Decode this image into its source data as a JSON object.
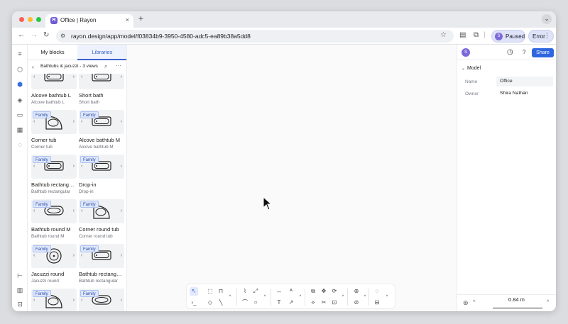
{
  "browser": {
    "tab_title": "Office | Rayon",
    "favicon_letter": "R",
    "new_tab": "+",
    "tab_close": "×",
    "tab_menu": "⌄",
    "url": "rayon.design/app/model/f03834b9-3950-4580-adc5-ea89b38a5dd8",
    "paused_label": "Paused",
    "profile_initial": "S",
    "error_label": "Error",
    "kebab": "⋮",
    "traffic_lights": [
      "#ff5f57",
      "#febc2e",
      "#28c840"
    ]
  },
  "panel": {
    "tabs": [
      {
        "label": "My blocks"
      },
      {
        "label": "Libraries"
      }
    ],
    "active_tab": "Libraries",
    "title": "Bathtubs & jacuzzi - 3 views",
    "back": "‹",
    "search": "⌕",
    "more": "···",
    "badge": "Family",
    "cards": [
      {
        "name": "Alcove bathtub L",
        "sub": "Alcove bathtub L",
        "badge": false,
        "icon": "bathtub-rect-icon"
      },
      {
        "name": "Short bath",
        "sub": "Short bath",
        "badge": false,
        "icon": "bathtub-rect-icon"
      },
      {
        "name": "Corner tub",
        "sub": "Corner tub",
        "badge": true,
        "icon": "corner-tub-icon"
      },
      {
        "name": "Alcove bathtub M",
        "sub": "Alcove bathtub M",
        "badge": true,
        "icon": "bathtub-rect-icon"
      },
      {
        "name": "Bathtub rectangular",
        "sub": "Bathtub rectangular",
        "badge": true,
        "icon": "bathtub-rect-icon"
      },
      {
        "name": "Drop-in",
        "sub": "Drop-in",
        "badge": true,
        "icon": "bathtub-rect-icon"
      },
      {
        "name": "Bathtub round M",
        "sub": "Bathtub round M",
        "badge": true,
        "icon": "bathtub-round-icon"
      },
      {
        "name": "Corner round tub",
        "sub": "Corner round tub",
        "badge": true,
        "icon": "corner-tub-icon"
      },
      {
        "name": "Jacuzzi round",
        "sub": "Jacuzzi round",
        "badge": true,
        "icon": "jacuzzi-round-icon"
      },
      {
        "name": "Bathtub rectangular",
        "sub": "Bathtub rectangular",
        "badge": true,
        "icon": "bathtub-rect-icon"
      },
      {
        "name": "",
        "sub": "",
        "badge": true,
        "icon": "corner-tub-icon"
      },
      {
        "name": "",
        "sub": "",
        "badge": true,
        "icon": "bathtub-round-icon"
      }
    ]
  },
  "inspector": {
    "avatar": "S",
    "help": "?",
    "share_label": "Share",
    "section": "Model",
    "rows": [
      {
        "label": "Name",
        "value": "Office"
      },
      {
        "label": "Owner",
        "value": "Shira Nathan"
      }
    ],
    "scale": "0.84 m",
    "chevron": "^"
  },
  "colors": {
    "accent": "#2f66e0",
    "badge_bg": "#dde6fb"
  }
}
